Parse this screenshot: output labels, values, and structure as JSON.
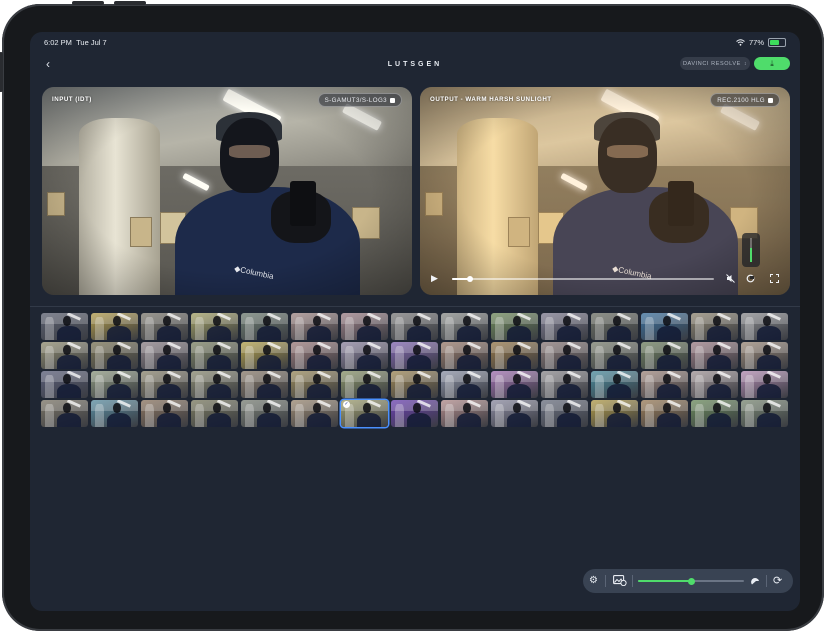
{
  "status_bar": {
    "time": "6:02 PM",
    "date": "Tue Jul 7",
    "battery": "77%",
    "battery_level": 0.77,
    "icons": [
      "wifi-icon",
      "battery-icon"
    ]
  },
  "header": {
    "title": "LUTSGEN",
    "back_icon": "chevron-left-icon",
    "export_icon": "download-icon"
  },
  "dropdown": {
    "selected": "DAVINCI RESOLVE"
  },
  "input_preview": {
    "label": "INPUT (IDT)",
    "color_space": "S-GAMUT3/S-LOG3"
  },
  "output_preview": {
    "label": "OUTPUT - WARM HARSH SUNLIGHT",
    "color_space": "REC.2100 HLG"
  },
  "playback": {
    "progress": 0.07,
    "volume": 0.6,
    "icons": [
      "play-icon",
      "mute-icon",
      "airplay-icon",
      "fullscreen-icon"
    ]
  },
  "lut_grid": {
    "selected_index": 51,
    "tints": [
      "#5b6070",
      "#b09a4a",
      "#7d7a70",
      "#a3a166",
      "#6e7d72",
      "#a08886",
      "#9c8087",
      "#7c7c7c",
      "#8a8d8a",
      "#6f8a5c",
      "#7c7a8e",
      "#6d7166",
      "#3a6f9c",
      "#8e8672",
      "#8a8b8e",
      "#8f8c70",
      "#7a7456",
      "#8c8288",
      "#7e8466",
      "#b3a14c",
      "#9c7c7c",
      "#8c84a0",
      "#8066b0",
      "#9a7c6c",
      "#96784a",
      "#8a7a78",
      "#7a8070",
      "#6f8060",
      "#9c7e86",
      "#9a8878",
      "#5a5e78",
      "#8d9880",
      "#8c8670",
      "#8a8a72",
      "#8a7c6c",
      "#9a8a5c",
      "#8a946a",
      "#9c8656",
      "#8c92a6",
      "#a070b0",
      "#8c8a8e",
      "#4a8a9c",
      "#a0887e",
      "#a09496",
      "#b08ab0",
      "#7a7466",
      "#5a8ca0",
      "#8a7460",
      "#7a7a60",
      "#7a8076",
      "#9a8872",
      "#a0a070",
      "#6a40b0",
      "#b08a8a",
      "#8a8aa0",
      "#6a7080",
      "#b09a48",
      "#9a7c58",
      "#6a8a5c",
      "#7a8874"
    ]
  },
  "toolbar": {
    "icons": [
      "gear-icon",
      "photo-settings-icon",
      "brightness-icon",
      "refresh-icon"
    ],
    "intensity": 0.5
  }
}
